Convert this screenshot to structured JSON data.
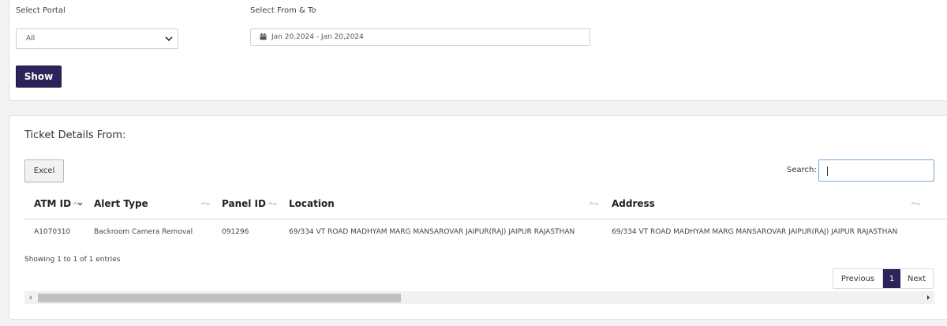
{
  "filters": {
    "portal_label": "Select Portal",
    "portal_value": "All",
    "range_label": "Select From & To",
    "range_value": "Jan 20,2024 - Jan 20,2024",
    "show_label": "Show"
  },
  "tickets": {
    "title": "Ticket Details From:",
    "excel_label": "Excel",
    "search_label": "Search:",
    "search_value": "",
    "columns": [
      "ATM ID",
      "Alert Type",
      "Panel ID",
      "Location",
      "Address"
    ],
    "rows": [
      [
        "A1070310",
        "Backroom Camera Removal",
        "091296",
        "69/334 VT ROAD MADHYAM MARG MANSAROVAR JAIPUR(RAJ) JAIPUR RAJASTHAN",
        "69/334 VT ROAD MADHYAM MARG MANSAROVAR JAIPUR(RAJ) JAIPUR RAJASTHAN"
      ]
    ],
    "info": "Showing 1 to 1 of 1 entries",
    "pagination": {
      "previous": "Previous",
      "current": "1",
      "next": "Next"
    }
  },
  "colors": {
    "primary": "#2d2359",
    "focus_border": "#7aa7d9"
  },
  "icons": {
    "select": "chevron-down-icon",
    "date": "calendar-icon",
    "sort": "sort-icon"
  }
}
